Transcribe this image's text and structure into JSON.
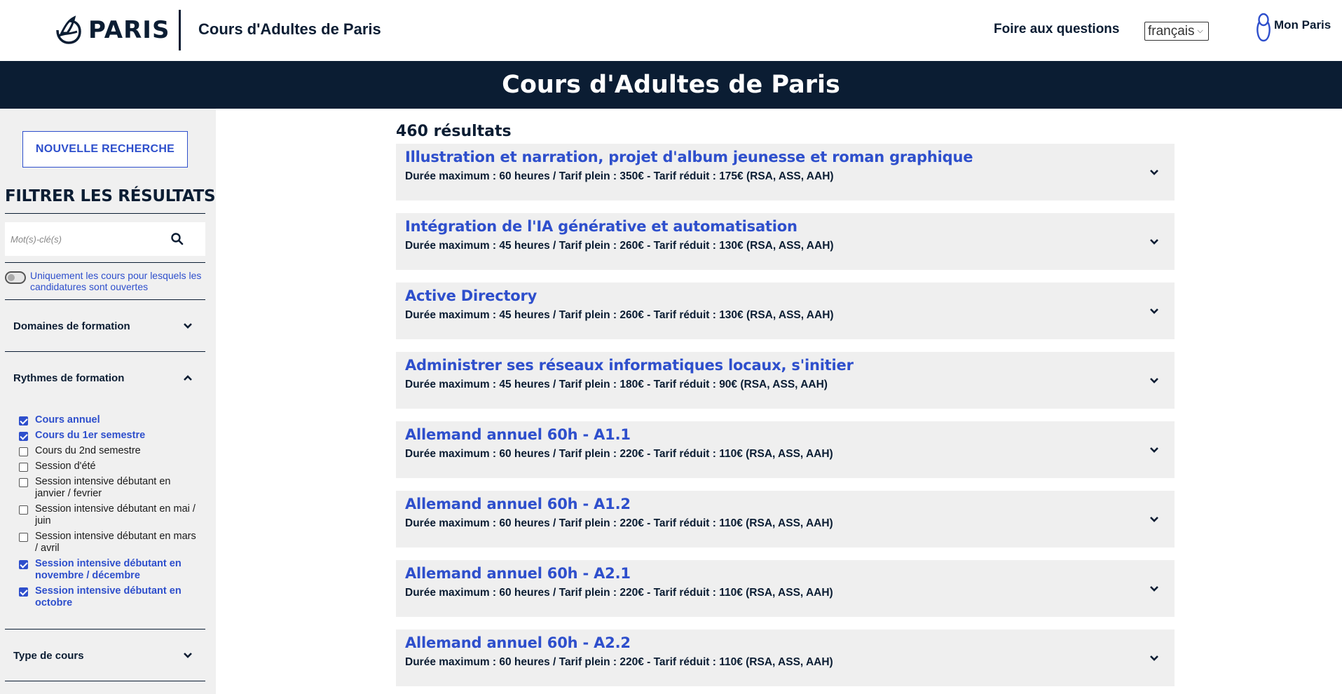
{
  "header": {
    "logo_text": "PARIS",
    "site_title": "Cours d'Adultes de Paris",
    "faq_label": "Foire aux questions",
    "language": "français",
    "account_label": "Mon Paris"
  },
  "hero": {
    "title": "Cours d'Adultes de Paris"
  },
  "sidebar": {
    "new_search_label": "NOUVELLE RECHERCHE",
    "filter_title": "FILTRER LES RÉSULTATS",
    "search_placeholder": "Mot(s)-clé(s)",
    "toggle_label": "Uniquement les cours pour lesquels les candidatures sont ouvertes",
    "toggle_on": false,
    "sections": [
      {
        "label": "Domaines de formation",
        "expanded": false
      },
      {
        "label": "Rythmes de formation",
        "expanded": true
      },
      {
        "label": "Type de cours",
        "expanded": false
      }
    ],
    "rhythm_options": [
      {
        "label": "Cours annuel",
        "checked": true
      },
      {
        "label": "Cours du 1er semestre",
        "checked": true
      },
      {
        "label": "Cours du 2nd semestre",
        "checked": false
      },
      {
        "label": "Session d'été",
        "checked": false
      },
      {
        "label": "Session intensive débutant en janvier / fevrier",
        "checked": false
      },
      {
        "label": "Session intensive débutant en mai / juin",
        "checked": false
      },
      {
        "label": "Session intensive débutant en mars / avril",
        "checked": false
      },
      {
        "label": "Session intensive débutant en novembre / décembre",
        "checked": true
      },
      {
        "label": "Session intensive débutant en octobre",
        "checked": true
      }
    ]
  },
  "results": {
    "count_label": "460 résultats",
    "items": [
      {
        "title": "Illustration et narration, projet d'album jeunesse et roman graphique",
        "details": "Durée maximum : 60 heures / Tarif plein : 350€ - Tarif réduit : 175€ (RSA, ASS, AAH)"
      },
      {
        "title": "Intégration de l'IA générative et automatisation",
        "details": "Durée maximum : 45 heures / Tarif plein : 260€ - Tarif réduit : 130€ (RSA, ASS, AAH)"
      },
      {
        "title": "Active Directory",
        "details": "Durée maximum : 45 heures / Tarif plein : 260€ - Tarif réduit : 130€ (RSA, ASS, AAH)"
      },
      {
        "title": "Administrer ses réseaux informatiques locaux, s'initier",
        "details": "Durée maximum : 45 heures / Tarif plein : 180€ - Tarif réduit : 90€ (RSA, ASS, AAH)"
      },
      {
        "title": "Allemand annuel 60h - A1.1",
        "details": "Durée maximum : 60 heures / Tarif plein : 220€ - Tarif réduit : 110€ (RSA, ASS, AAH)"
      },
      {
        "title": "Allemand annuel 60h - A1.2",
        "details": "Durée maximum : 60 heures / Tarif plein : 220€ - Tarif réduit : 110€ (RSA, ASS, AAH)"
      },
      {
        "title": "Allemand annuel 60h - A2.1",
        "details": "Durée maximum : 60 heures / Tarif plein : 220€ - Tarif réduit : 110€ (RSA, ASS, AAH)"
      },
      {
        "title": "Allemand annuel 60h - A2.2",
        "details": "Durée maximum : 60 heures / Tarif plein : 220€ - Tarif réduit : 110€ (RSA, ASS, AAH)"
      }
    ]
  },
  "colors": {
    "navy": "#0b1d33",
    "accent_blue": "#2e4fcc",
    "panel_grey": "#f0f0f0",
    "card_grey": "#efefef"
  },
  "icons": [
    "paris-ship-logo-icon",
    "search-icon",
    "chevron-down-icon",
    "chevron-up-icon",
    "mon-paris-user-icon"
  ]
}
